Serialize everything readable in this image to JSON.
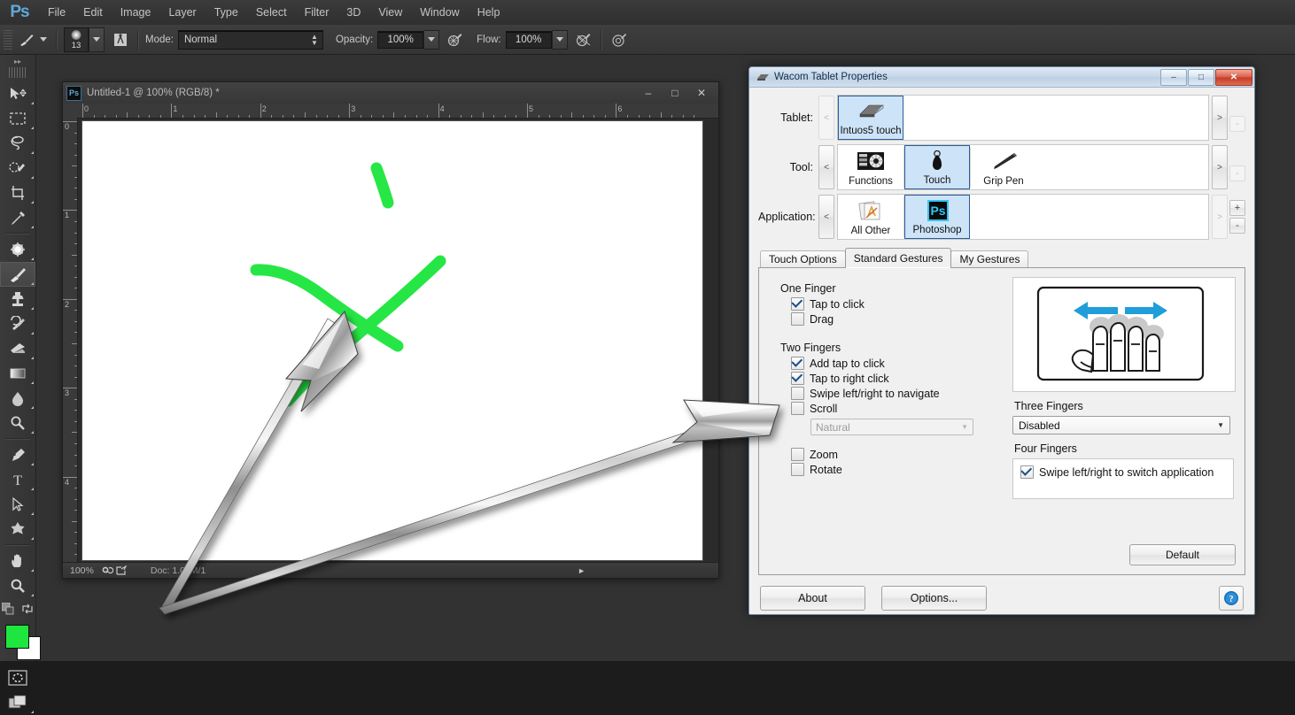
{
  "app": {
    "name": "Adobe Photoshop",
    "logo_text": "Ps",
    "menu": [
      "File",
      "Edit",
      "Image",
      "Layer",
      "Type",
      "Select",
      "Filter",
      "3D",
      "View",
      "Window",
      "Help"
    ]
  },
  "options_bar": {
    "brush_icon": "brush-icon",
    "brush_size": "13",
    "brush_panel_icon": "brush-panel-icon",
    "mode_label": "Mode:",
    "mode_value": "Normal",
    "opacity_label": "Opacity:",
    "opacity_value": "100%",
    "opacity_pressure_icon": "pressure-opacity-icon",
    "flow_label": "Flow:",
    "flow_value": "100%",
    "airbrush_icon": "airbrush-icon",
    "smoothing_icon": "pressure-size-icon"
  },
  "toolbar": {
    "collapse_icon": "collapse-panel-icon",
    "tools": [
      {
        "name": "move-tool",
        "icon": "move-arrow-icon",
        "selected": false
      },
      {
        "name": "marquee-tool",
        "icon": "rectangular-marquee-icon",
        "selected": false
      },
      {
        "name": "lasso-tool",
        "icon": "lasso-icon",
        "selected": false
      },
      {
        "name": "quick-selection-tool",
        "icon": "quick-selection-icon",
        "selected": false
      },
      {
        "name": "crop-tool",
        "icon": "crop-icon",
        "selected": false
      },
      {
        "name": "eyedropper-tool",
        "icon": "eyedropper-icon",
        "selected": false
      },
      {
        "name": "spot-healing-tool",
        "icon": "spot-healing-icon",
        "selected": false
      },
      {
        "name": "brush-tool",
        "icon": "brush-icon",
        "selected": true
      },
      {
        "name": "clone-stamp-tool",
        "icon": "clone-stamp-icon",
        "selected": false
      },
      {
        "name": "history-brush-tool",
        "icon": "history-brush-icon",
        "selected": false
      },
      {
        "name": "eraser-tool",
        "icon": "eraser-icon",
        "selected": false
      },
      {
        "name": "gradient-tool",
        "icon": "gradient-icon",
        "selected": false
      },
      {
        "name": "blur-tool",
        "icon": "blur-drop-icon",
        "selected": false
      },
      {
        "name": "dodge-tool",
        "icon": "dodge-icon",
        "selected": false
      },
      {
        "name": "pen-tool",
        "icon": "pen-icon",
        "selected": false
      },
      {
        "name": "type-tool",
        "icon": "type-t-icon",
        "selected": false
      },
      {
        "name": "path-selection-tool",
        "icon": "path-arrow-icon",
        "selected": false
      },
      {
        "name": "shape-tool",
        "icon": "custom-shape-icon",
        "selected": false
      },
      {
        "name": "hand-tool",
        "icon": "hand-icon",
        "selected": false
      },
      {
        "name": "zoom-tool",
        "icon": "magnifier-icon",
        "selected": false
      }
    ],
    "foreground_color": "#1fe63f",
    "background_color": "#ffffff",
    "swap_icon": "swap-colors-icon",
    "default_colors_icon": "default-colors-icon",
    "quick_mask_icon": "quick-mask-icon",
    "screen_mode_icon": "screen-mode-icon"
  },
  "document": {
    "ps_badge": "Ps",
    "title": "Untitled-1 @ 100% (RGB/8) *",
    "minimize_icon": "minimize-icon",
    "maximize_icon": "maximize-icon",
    "close_icon": "close-icon",
    "ruler_h_labels": [
      "0",
      "1",
      "2",
      "3",
      "4",
      "5",
      "6"
    ],
    "ruler_v_labels": [
      "0",
      "1",
      "2",
      "3",
      "4"
    ],
    "status_zoom": "100%",
    "status_doc": "Doc: 1.00M/1",
    "status_icons": [
      "settings-icon",
      "share-icon"
    ],
    "status_arrow_icon": "play-arrow-icon",
    "canvas": {
      "stroke_color": "#1fe63f",
      "description": "green brush strokes"
    }
  },
  "wacom_dialog": {
    "icon": "tablet-icon",
    "title": "Wacom Tablet Properties",
    "window_buttons": {
      "minimize": "–",
      "maximize": "□",
      "close": "✕"
    },
    "rows": [
      {
        "label": "Tablet:",
        "prev_enabled": false,
        "next_enabled": true,
        "items": [
          {
            "label": "Intuos5 touch",
            "icon": "tablet-device-icon",
            "selected": true
          }
        ]
      },
      {
        "label": "Tool:",
        "prev_enabled": true,
        "next_enabled": true,
        "items": [
          {
            "label": "Functions",
            "icon": "express-keys-icon",
            "selected": false
          },
          {
            "label": "Touch",
            "icon": "touch-finger-icon",
            "selected": true
          },
          {
            "label": "Grip Pen",
            "icon": "grip-pen-icon",
            "selected": false
          }
        ]
      },
      {
        "label": "Application:",
        "prev_enabled": true,
        "next_enabled": false,
        "items": [
          {
            "label": "All Other",
            "icon": "all-other-apps-icon",
            "selected": false
          },
          {
            "label": "Photoshop",
            "icon": "photoshop-app-icon",
            "selected": true
          }
        ]
      }
    ],
    "app_add_button": "+",
    "app_remove_button": "-",
    "tabs": [
      {
        "label": "Touch Options",
        "active": false
      },
      {
        "label": "Standard Gestures",
        "active": true
      },
      {
        "label": "My Gestures",
        "active": false
      }
    ],
    "panel": {
      "one_finger": {
        "title": "One Finger",
        "options": [
          {
            "label": "Tap to click",
            "checked": true
          },
          {
            "label": "Drag",
            "checked": false
          }
        ]
      },
      "two_fingers": {
        "title": "Two Fingers",
        "options": [
          {
            "label": "Add tap to click",
            "checked": true
          },
          {
            "label": "Tap to right click",
            "checked": true
          },
          {
            "label": "Swipe left/right to navigate",
            "checked": false
          },
          {
            "label": "Scroll",
            "checked": false
          }
        ],
        "scroll_dropdown_value": "Natural",
        "extra_options": [
          {
            "label": "Zoom",
            "checked": false
          },
          {
            "label": "Rotate",
            "checked": false
          }
        ]
      },
      "illustration": {
        "name": "three-finger-swipe-illustration",
        "arrow_color": "#1f9ed9"
      },
      "three_fingers": {
        "title": "Three Fingers",
        "value": "Disabled"
      },
      "four_fingers": {
        "title": "Four Fingers",
        "options": [
          {
            "label": "Swipe left/right to switch application",
            "checked": true
          }
        ]
      },
      "default_button": "Default"
    },
    "footer": {
      "about": "About",
      "options": "Options...",
      "help_icon": "help-question-icon"
    }
  }
}
